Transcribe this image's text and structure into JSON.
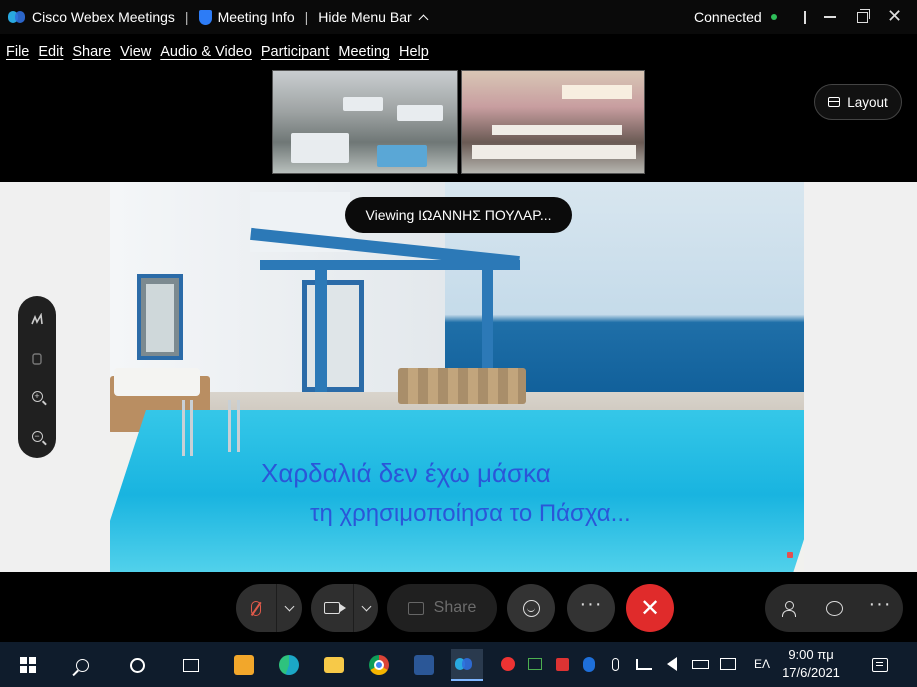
{
  "titlebar": {
    "app_name": "Cisco Webex Meetings",
    "meeting_info": "Meeting Info",
    "hide_menu_bar": "Hide Menu Bar",
    "status": "Connected",
    "separator": "|",
    "close_glyph": "✕"
  },
  "menu": [
    "File",
    "Edit",
    "Share",
    "View",
    "Audio & Video",
    "Participant",
    "Meeting",
    "Help"
  ],
  "layout_button": "Layout",
  "viewing_label": "Viewing ΙΩΑΝΝΗΣ ΠΟΥΛΑΡ...",
  "slide": {
    "line1": "Χαρδαλιά δεν έχω μάσκα",
    "line2": "τη χρησιμοποίησα το Πάσχα..."
  },
  "controls": {
    "share_label": "Share",
    "end_glyph": "✕",
    "more_glyph": "···"
  },
  "annotation_tools": {
    "zoom_in_glyph": "+",
    "zoom_out_glyph": "−"
  },
  "taskbar": {
    "language": "ΕΛ",
    "time": "9:00 πμ",
    "date": "17/6/2021"
  },
  "colors": {
    "connected_dot": "#2fbf5a",
    "end_button": "#e02b2b",
    "slide_text": "#2b56d8",
    "muted_mic": "#e05a4a"
  }
}
